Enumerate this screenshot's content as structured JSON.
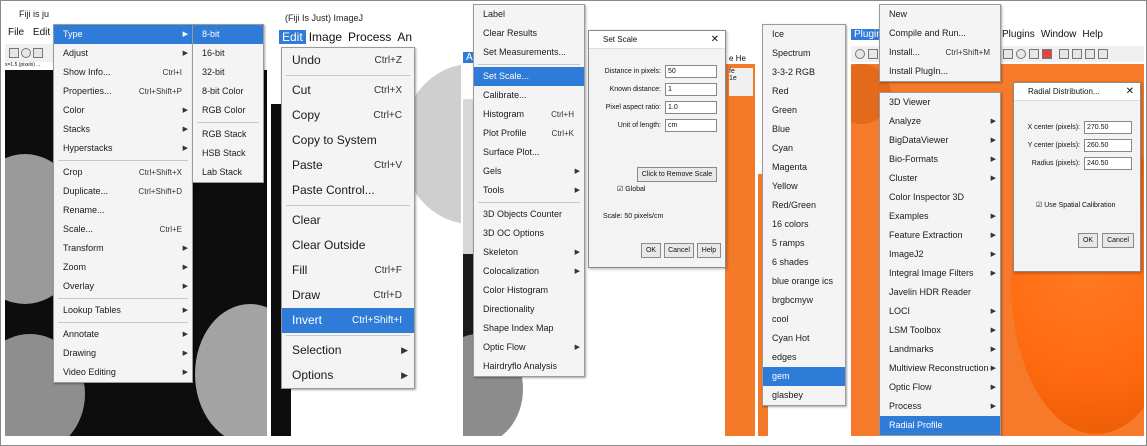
{
  "panel1": {
    "title": "Fiji is ju",
    "menubar_left": "File",
    "menubar_edit": "Edit",
    "status": "x=1.5 (pixels) ...",
    "image_menu": [
      {
        "label": "Type",
        "highlighted": true,
        "arrow": true
      },
      {
        "label": "Adjust",
        "arrow": true
      },
      {
        "label": "Show Info...",
        "shortcut": "Ctrl+I"
      },
      {
        "label": "Properties...",
        "shortcut": "Ctrl+Shift+P"
      },
      {
        "label": "Color",
        "arrow": true
      },
      {
        "label": "Stacks",
        "arrow": true
      },
      {
        "label": "Hyperstacks",
        "arrow": true
      },
      {
        "sep": true
      },
      {
        "label": "Crop",
        "shortcut": "Ctrl+Shift+X"
      },
      {
        "label": "Duplicate...",
        "shortcut": "Ctrl+Shift+D"
      },
      {
        "label": "Rename..."
      },
      {
        "label": "Scale...",
        "shortcut": "Ctrl+E"
      },
      {
        "label": "Transform",
        "arrow": true
      },
      {
        "label": "Zoom",
        "arrow": true
      },
      {
        "label": "Overlay",
        "arrow": true
      },
      {
        "sep": true
      },
      {
        "label": "Lookup Tables",
        "arrow": true
      },
      {
        "sep": true
      },
      {
        "label": "Annotate",
        "arrow": true
      },
      {
        "label": "Drawing",
        "arrow": true
      },
      {
        "label": "Video Editing",
        "arrow": true
      }
    ],
    "type_submenu": [
      {
        "label": "8-bit",
        "highlighted": true
      },
      {
        "label": "16-bit"
      },
      {
        "label": "32-bit"
      },
      {
        "label": "8-bit Color"
      },
      {
        "label": "RGB Color"
      },
      {
        "sep": true
      },
      {
        "label": "RGB Stack"
      },
      {
        "label": "HSB Stack"
      },
      {
        "label": "Lab Stack"
      }
    ]
  },
  "panel2": {
    "title": "(Fiji Is Just) ImageJ",
    "menubar": [
      "Edit",
      "Image",
      "Process",
      "An"
    ],
    "edit_menu": [
      {
        "label": "Undo",
        "shortcut": "Ctrl+Z"
      },
      {
        "sep": true
      },
      {
        "label": "Cut",
        "shortcut": "Ctrl+X"
      },
      {
        "label": "Copy",
        "shortcut": "Ctrl+C"
      },
      {
        "label": "Copy to System"
      },
      {
        "label": "Paste",
        "shortcut": "Ctrl+V"
      },
      {
        "label": "Paste Control..."
      },
      {
        "sep": true
      },
      {
        "label": "Clear"
      },
      {
        "label": "Clear Outside"
      },
      {
        "label": "Fill",
        "shortcut": "Ctrl+F"
      },
      {
        "label": "Draw",
        "shortcut": "Ctrl+D"
      },
      {
        "label": "Invert",
        "shortcut": "Ctrl+Shift+I",
        "highlighted": true
      },
      {
        "sep": true
      },
      {
        "label": "Selection",
        "arrow": true
      },
      {
        "label": "Options",
        "arrow": true
      }
    ]
  },
  "panel3": {
    "menubar_active": "Analyze",
    "analyze_menu": [
      {
        "label": "Label"
      },
      {
        "label": "Clear Results"
      },
      {
        "label": "Set Measurements..."
      },
      {
        "sep": true
      },
      {
        "label": "Set Scale...",
        "highlighted": true
      },
      {
        "label": "Calibrate..."
      },
      {
        "label": "Histogram",
        "shortcut": "Ctrl+H"
      },
      {
        "label": "Plot Profile",
        "shortcut": "Ctrl+K"
      },
      {
        "label": "Surface Plot..."
      },
      {
        "label": "Gels",
        "arrow": true
      },
      {
        "label": "Tools",
        "arrow": true
      },
      {
        "sep": true
      },
      {
        "label": "3D Objects Counter"
      },
      {
        "label": "3D OC Options"
      },
      {
        "label": "Skeleton",
        "arrow": true
      },
      {
        "label": "Colocalization",
        "arrow": true
      },
      {
        "label": "Color Histogram"
      },
      {
        "label": "Directionality"
      },
      {
        "label": "Shape Index Map"
      },
      {
        "label": "Optic Flow",
        "arrow": true
      },
      {
        "label": "Hairdryflo Analysis"
      }
    ],
    "set_scale": {
      "title": "Set Scale",
      "fields": [
        {
          "label": "Distance in pixels:",
          "value": "50"
        },
        {
          "label": "Known distance:",
          "value": "1"
        },
        {
          "label": "Pixel aspect ratio:",
          "value": "1.0"
        },
        {
          "label": "Unit of length:",
          "value": "cm"
        }
      ],
      "remove_button": "Click to Remove Scale",
      "global_label": "Global",
      "scale_text": "Scale: 50 pixels/cm",
      "ok": "OK",
      "cancel": "Cancel",
      "help": "Help"
    },
    "side_menubar": [
      "e",
      "He"
    ],
    "side_menubar2": "fe",
    "side_menubar3": "1e"
  },
  "panel4": {
    "lut_menu": [
      {
        "label": "Ice"
      },
      {
        "label": "Spectrum"
      },
      {
        "label": "3-3-2 RGB"
      },
      {
        "label": "Red"
      },
      {
        "label": "Green"
      },
      {
        "label": "Blue"
      },
      {
        "label": "Cyan"
      },
      {
        "label": "Magenta"
      },
      {
        "label": "Yellow"
      },
      {
        "label": "Red/Green"
      },
      {
        "label": "16 colors"
      },
      {
        "label": "5 ramps"
      },
      {
        "label": "6 shades"
      },
      {
        "label": "blue orange ics"
      },
      {
        "label": "brgbcmyw"
      },
      {
        "label": "cool"
      },
      {
        "label": "Cyan Hot"
      },
      {
        "label": "edges"
      },
      {
        "label": "gem",
        "highlighted": true
      },
      {
        "label": "glasbey"
      }
    ]
  },
  "panel5": {
    "menubar": [
      "Plugins",
      "Window",
      "Help"
    ],
    "analyze_active": "Plugins",
    "top_items": [
      {
        "label": "New"
      },
      {
        "label": "Compile and Run..."
      },
      {
        "label": "Install...",
        "shortcut": "Ctrl+Shift+M"
      },
      {
        "label": "Install PlugIn..."
      }
    ],
    "plugins_menu": [
      {
        "label": "3D Viewer"
      },
      {
        "label": "Analyze",
        "arrow": true
      },
      {
        "label": "BigDataViewer",
        "arrow": true
      },
      {
        "label": "Bio-Formats",
        "arrow": true
      },
      {
        "label": "Cluster",
        "arrow": true
      },
      {
        "label": "Color Inspector 3D"
      },
      {
        "label": "Examples",
        "arrow": true
      },
      {
        "label": "Feature Extraction",
        "arrow": true
      },
      {
        "label": "ImageJ2",
        "arrow": true
      },
      {
        "label": "Integral Image Filters",
        "arrow": true
      },
      {
        "label": "Javelin HDR Reader"
      },
      {
        "label": "LOCI",
        "arrow": true
      },
      {
        "label": "LSM Toolbox",
        "arrow": true
      },
      {
        "label": "Landmarks",
        "arrow": true
      },
      {
        "label": "Multiview Reconstruction",
        "arrow": true
      },
      {
        "label": "Optic Flow",
        "arrow": true
      },
      {
        "label": "Process",
        "arrow": true
      },
      {
        "label": "Radial Profile",
        "highlighted": true
      }
    ],
    "radial": {
      "title": "Radial Distribution...",
      "fields": [
        {
          "label": "X center (pixels):",
          "value": "270.50"
        },
        {
          "label": "Y center (pixels):",
          "value": "260.50"
        },
        {
          "label": "Radius (pixels):",
          "value": "240.50"
        }
      ],
      "checkbox": "Use Spatial Calibration",
      "ok": "OK",
      "cancel": "Cancel"
    }
  },
  "colors": {
    "highlight": "#2f7bd8",
    "orange": "#ff6a10",
    "dark": "#0d0d0d"
  }
}
